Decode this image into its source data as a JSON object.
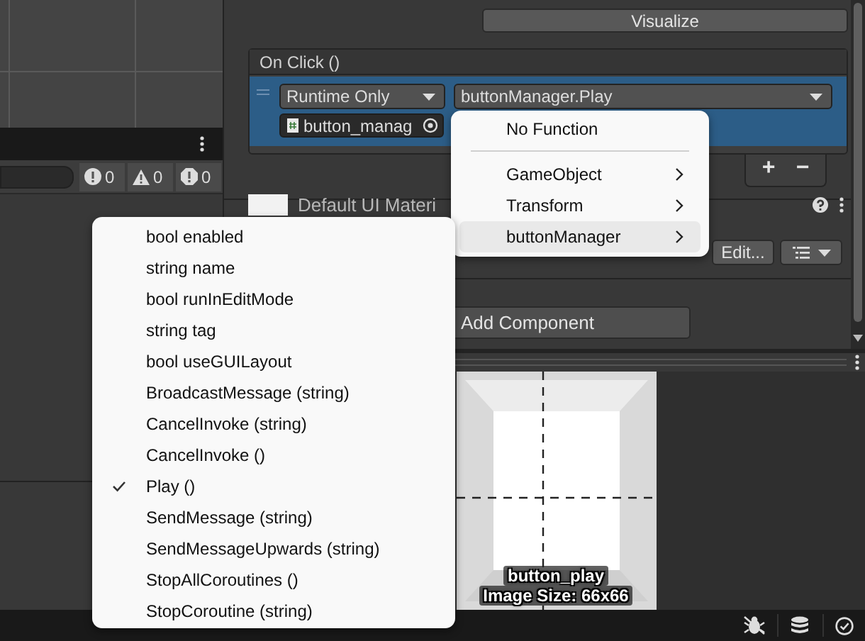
{
  "console": {
    "counters": [
      {
        "kind": "error",
        "count": "0"
      },
      {
        "kind": "warning",
        "count": "0"
      },
      {
        "kind": "info",
        "count": "0"
      }
    ]
  },
  "inspector": {
    "visualize_button": "Visualize",
    "on_click": {
      "title": "On Click ()",
      "call_state": "Runtime Only",
      "function": "buttonManager.Play",
      "target": "button_manag",
      "add_button": "+",
      "remove_button": "−"
    },
    "material": {
      "name": "Default UI Materi",
      "edit_button": "Edit..."
    },
    "add_component_button": "Add Component"
  },
  "preview": {
    "name": "button_play",
    "size": "Image Size: 66x66"
  },
  "function_menu": {
    "items": [
      {
        "kind": "item",
        "label": "No Function",
        "submenu": false,
        "selected": false
      },
      {
        "kind": "separator"
      },
      {
        "kind": "item",
        "label": "GameObject",
        "submenu": true,
        "selected": false
      },
      {
        "kind": "item",
        "label": "Transform",
        "submenu": true,
        "selected": false
      },
      {
        "kind": "item",
        "label": "buttonManager",
        "submenu": true,
        "selected": true
      }
    ]
  },
  "members_menu": {
    "items": [
      {
        "label": "bool enabled",
        "checked": false
      },
      {
        "label": "string name",
        "checked": false
      },
      {
        "label": "bool runInEditMode",
        "checked": false
      },
      {
        "label": "string tag",
        "checked": false
      },
      {
        "label": "bool useGUILayout",
        "checked": false
      },
      {
        "label": "BroadcastMessage (string)",
        "checked": false
      },
      {
        "label": "CancelInvoke (string)",
        "checked": false
      },
      {
        "label": "CancelInvoke ()",
        "checked": false
      },
      {
        "label": "Play ()",
        "checked": true
      },
      {
        "label": "SendMessage (string)",
        "checked": false
      },
      {
        "label": "SendMessageUpwards (string)",
        "checked": false
      },
      {
        "label": "StopAllCoroutines ()",
        "checked": false
      },
      {
        "label": "StopCoroutine (string)",
        "checked": false
      }
    ]
  }
}
